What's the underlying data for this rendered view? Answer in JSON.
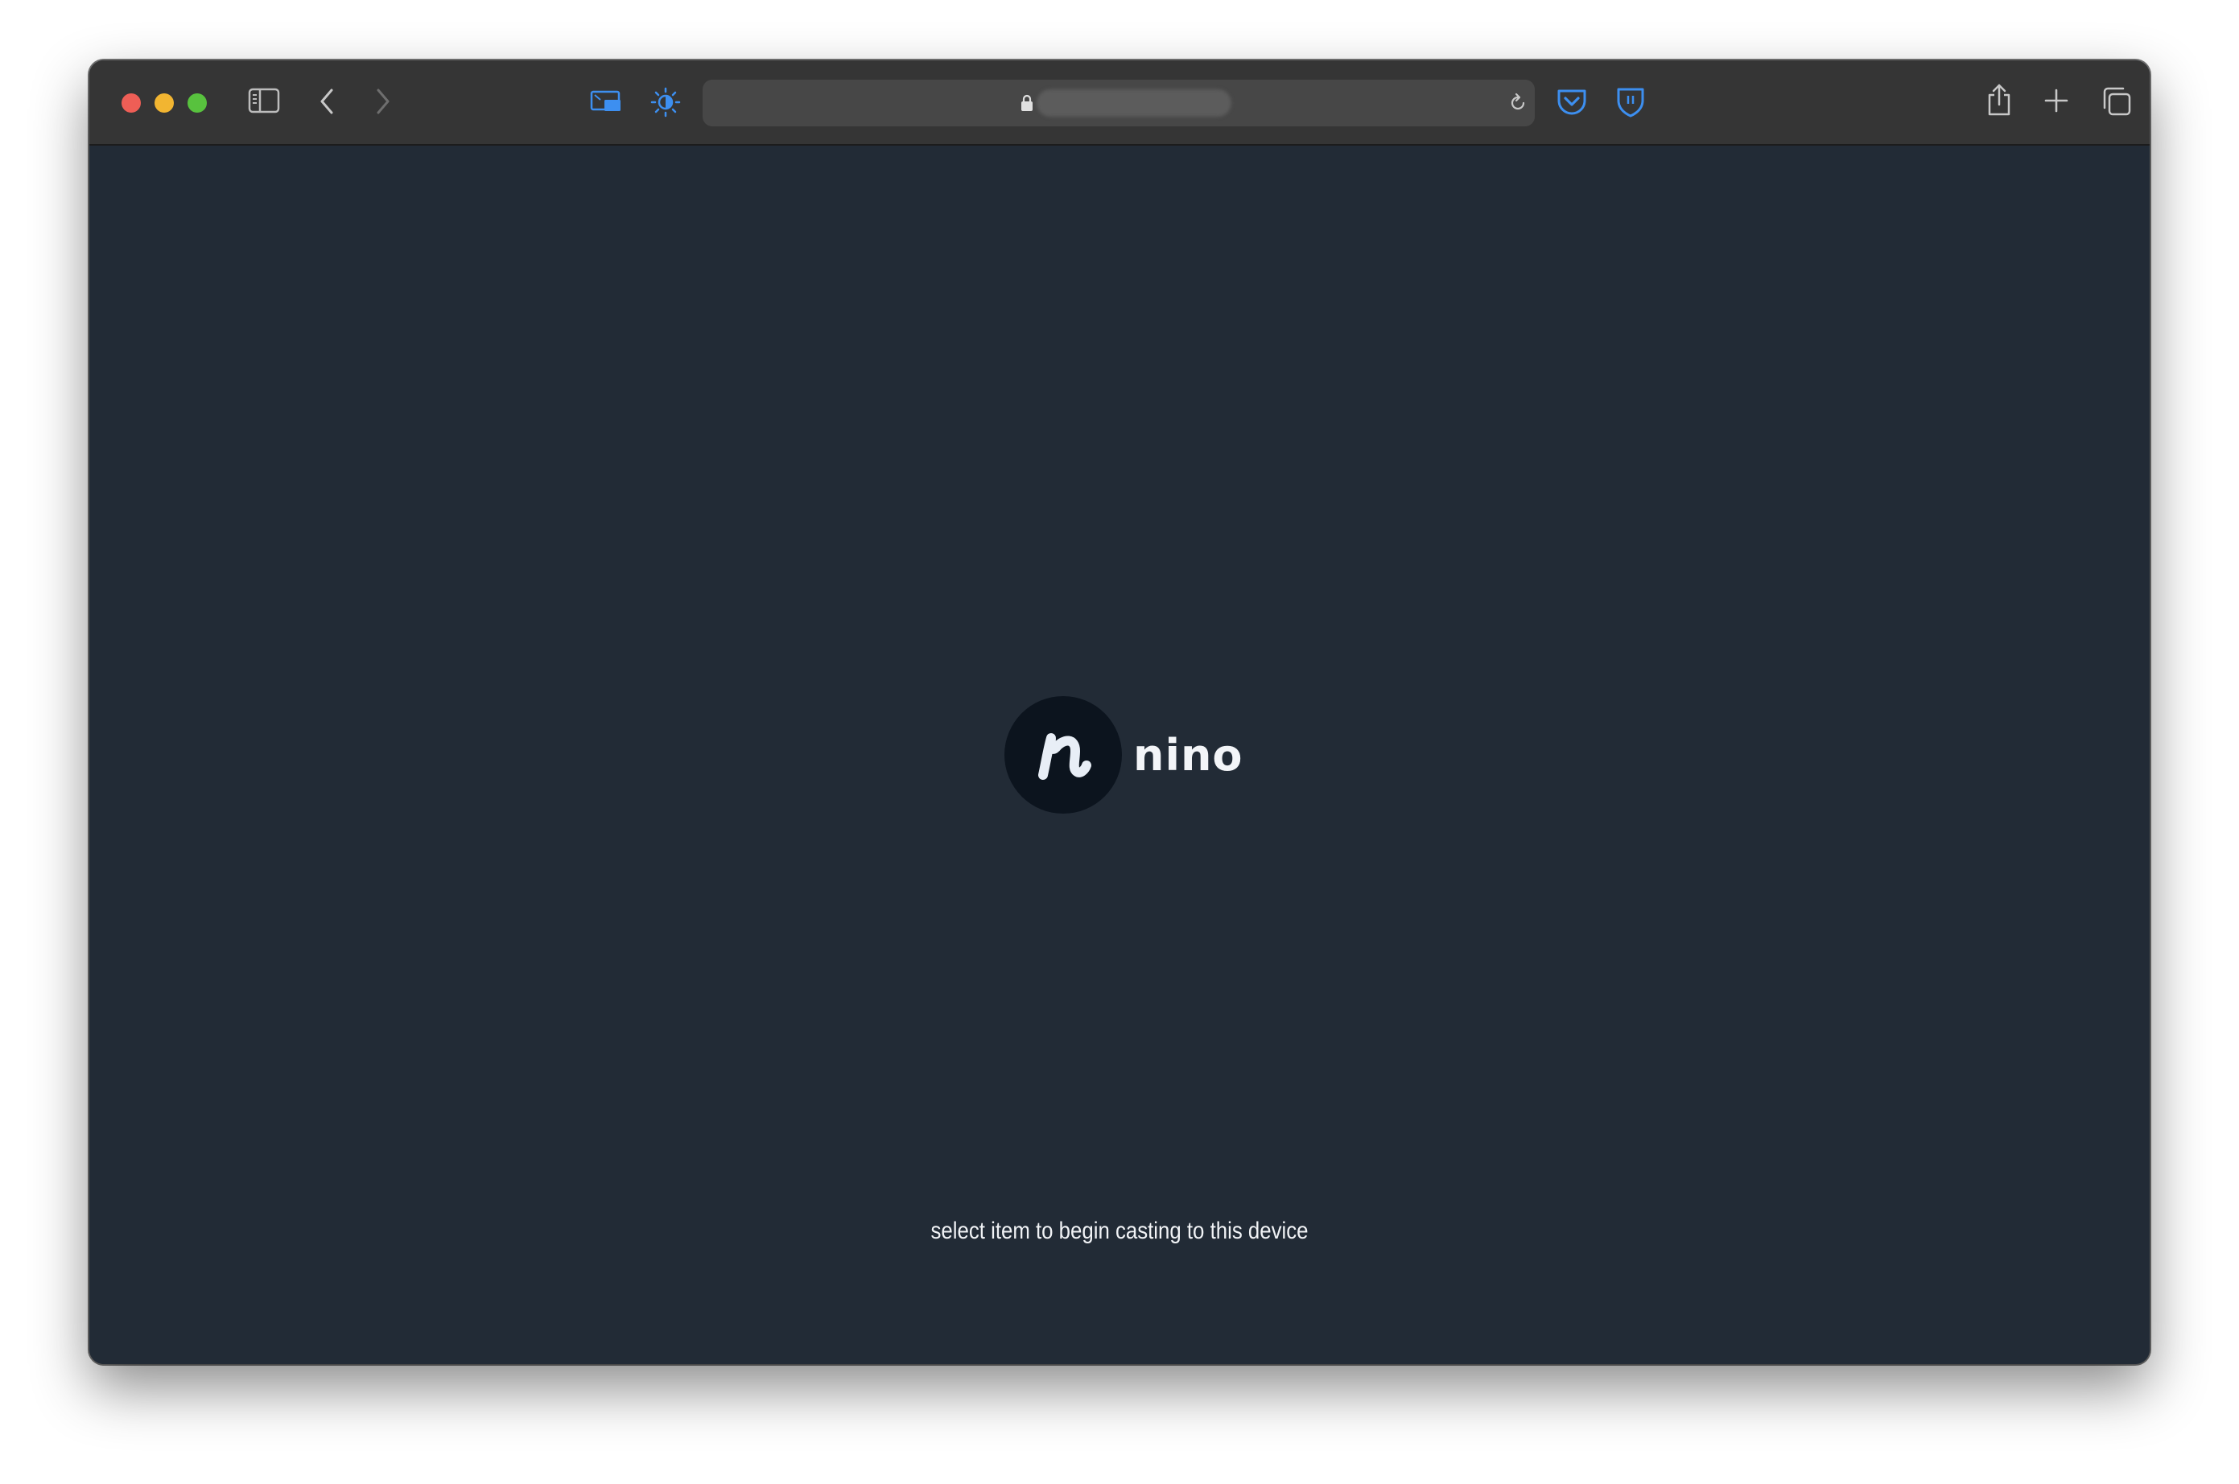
{
  "browser": {
    "traffic_lights": {
      "close_color": "#ee5e56",
      "minimize_color": "#f2b531",
      "maximize_color": "#58c23e"
    },
    "toolbar_icons": [
      "sidebar-icon",
      "back-icon",
      "forward-icon",
      "picture-in-picture-icon",
      "brightness-icon",
      "lock-icon",
      "reload-icon",
      "pocket-icon",
      "bitwarden-shield-icon",
      "share-icon",
      "new-tab-icon",
      "tab-overview-icon"
    ],
    "accent_color": "#3d8ff0",
    "address_bar": {
      "url": ""
    }
  },
  "page": {
    "background_color": "#222b36",
    "logo": {
      "mark": "n",
      "name": "nino"
    },
    "caption": "select item to begin casting to this device"
  }
}
